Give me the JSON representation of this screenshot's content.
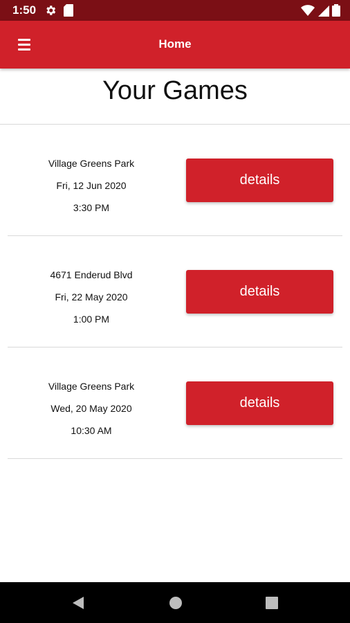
{
  "status_bar": {
    "time": "1:50",
    "icons": [
      "gear-icon",
      "sd-card-icon",
      "wifi-icon",
      "signal-icon",
      "battery-icon"
    ]
  },
  "app_bar": {
    "title": "Home",
    "menu_icon": "hamburger-menu-icon",
    "color": "#d0212a"
  },
  "page": {
    "title": "Your Games"
  },
  "games": [
    {
      "location": "Village Greens Park",
      "date": "Fri, 12 Jun 2020",
      "time": "3:30 PM",
      "button_label": "details"
    },
    {
      "location": "4671 Enderud Blvd",
      "date": "Fri, 22 May 2020",
      "time": "1:00 PM",
      "button_label": "details"
    },
    {
      "location": "Village Greens Park",
      "date": "Wed, 20 May 2020",
      "time": "10:30 AM",
      "button_label": "details"
    }
  ],
  "nav_bar": {
    "icons": [
      "back-icon",
      "home-icon",
      "recents-icon"
    ]
  },
  "colors": {
    "accent": "#d0212a",
    "status_bar": "#7b0f15",
    "nav_bar": "#000000"
  }
}
